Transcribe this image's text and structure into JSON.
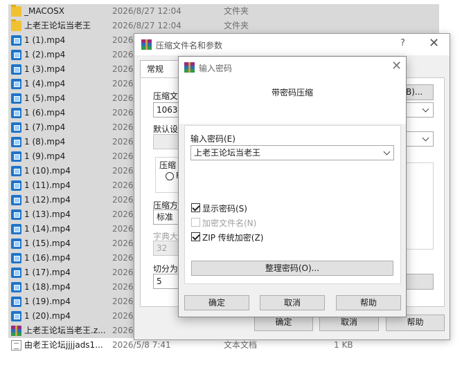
{
  "files": [
    {
      "name": "_MACOSX",
      "date": "2026/8/27 12:04",
      "type": "文件夹",
      "size": "",
      "icon": "folder-icon",
      "selected": true
    },
    {
      "name": "上老王论坛当老王",
      "date": "2026/8/27 12:04",
      "type": "文件夹",
      "size": "",
      "icon": "folder-icon",
      "selected": true
    },
    {
      "name": "1 (1).mp4",
      "date": "2026/",
      "type": "",
      "size": "",
      "icon": "mp4-icon",
      "selected": true
    },
    {
      "name": "1 (2).mp4",
      "date": "2026/",
      "type": "",
      "size": "",
      "icon": "mp4-icon",
      "selected": true
    },
    {
      "name": "1 (3).mp4",
      "date": "2026/",
      "type": "",
      "size": "",
      "icon": "mp4-icon",
      "selected": true
    },
    {
      "name": "1 (4).mp4",
      "date": "2026/",
      "type": "",
      "size": "",
      "icon": "mp4-icon",
      "selected": true
    },
    {
      "name": "1 (5).mp4",
      "date": "2026/",
      "type": "",
      "size": "",
      "icon": "mp4-icon",
      "selected": true
    },
    {
      "name": "1 (6).mp4",
      "date": "2026/",
      "type": "",
      "size": "",
      "icon": "mp4-icon",
      "selected": true
    },
    {
      "name": "1 (7).mp4",
      "date": "2026/",
      "type": "",
      "size": "",
      "icon": "mp4-icon",
      "selected": true
    },
    {
      "name": "1 (8).mp4",
      "date": "2026/",
      "type": "",
      "size": "",
      "icon": "mp4-icon",
      "selected": true
    },
    {
      "name": "1 (9).mp4",
      "date": "2026/",
      "type": "",
      "size": "",
      "icon": "mp4-icon",
      "selected": true
    },
    {
      "name": "1 (10).mp4",
      "date": "2026/",
      "type": "",
      "size": "",
      "icon": "mp4-icon",
      "selected": true
    },
    {
      "name": "1 (11).mp4",
      "date": "2026/",
      "type": "",
      "size": "",
      "icon": "mp4-icon",
      "selected": true
    },
    {
      "name": "1 (12).mp4",
      "date": "2026/",
      "type": "",
      "size": "",
      "icon": "mp4-icon",
      "selected": true
    },
    {
      "name": "1 (13).mp4",
      "date": "2026/",
      "type": "",
      "size": "",
      "icon": "mp4-icon",
      "selected": true
    },
    {
      "name": "1 (14).mp4",
      "date": "2026/",
      "type": "",
      "size": "",
      "icon": "mp4-icon",
      "selected": true
    },
    {
      "name": "1 (15).mp4",
      "date": "2026/",
      "type": "",
      "size": "",
      "icon": "mp4-icon",
      "selected": true
    },
    {
      "name": "1 (16).mp4",
      "date": "2026/",
      "type": "",
      "size": "",
      "icon": "mp4-icon",
      "selected": true
    },
    {
      "name": "1 (17).mp4",
      "date": "2026/",
      "type": "",
      "size": "",
      "icon": "mp4-icon",
      "selected": true
    },
    {
      "name": "1 (18).mp4",
      "date": "2026/",
      "type": "",
      "size": "",
      "icon": "mp4-icon",
      "selected": true
    },
    {
      "name": "1 (19).mp4",
      "date": "2026/",
      "type": "",
      "size": "",
      "icon": "mp4-icon",
      "selected": true
    },
    {
      "name": "1 (20).mp4",
      "date": "2026/",
      "type": "",
      "size": "",
      "icon": "mp4-icon",
      "selected": true
    },
    {
      "name": "上老王论坛当老王.z...",
      "date": "2026/",
      "type": "",
      "size": "",
      "icon": "rar-archive-icon",
      "selected": true
    },
    {
      "name": "由老王论坛jjjjads1...",
      "date": "2026/5/8 7:41",
      "type": "文本文档",
      "size": "1 KB",
      "icon": "text-document-icon",
      "selected": false
    }
  ],
  "main_dialog": {
    "title": "压缩文件名和参数",
    "help_glyph": "?",
    "close_glyph": "✕",
    "tab_general": "常规",
    "archive_name_label": "压缩文",
    "archive_name_value": "1063.z",
    "browse_button": "B)...",
    "default_profile_label": "默认设",
    "format_group_label": "压缩",
    "format_radio_label": "R",
    "method_label": "压缩方",
    "method_value": "标准",
    "dictionary_label": "字典大",
    "dictionary_value": "32",
    "split_label": "切分为",
    "split_value": "5",
    "ok_button": "确定",
    "cancel_button": "取消",
    "help_button": "帮助"
  },
  "password_dialog": {
    "title": "输入密码",
    "close_glyph": "✕",
    "heading": "带密码压缩",
    "password_label": "输入密码(E)",
    "password_value": "上老王论坛当老王",
    "show_password_label": "显示密码(S)",
    "show_password_checked": true,
    "encrypt_filenames_label": "加密文件名(N)",
    "encrypt_filenames_checked": false,
    "zip_legacy_label": "ZIP 传统加密(Z)",
    "zip_legacy_checked": true,
    "organize_button": "整理密码(O)...",
    "ok_button": "确定",
    "cancel_button": "取消",
    "help_button": "帮助"
  }
}
